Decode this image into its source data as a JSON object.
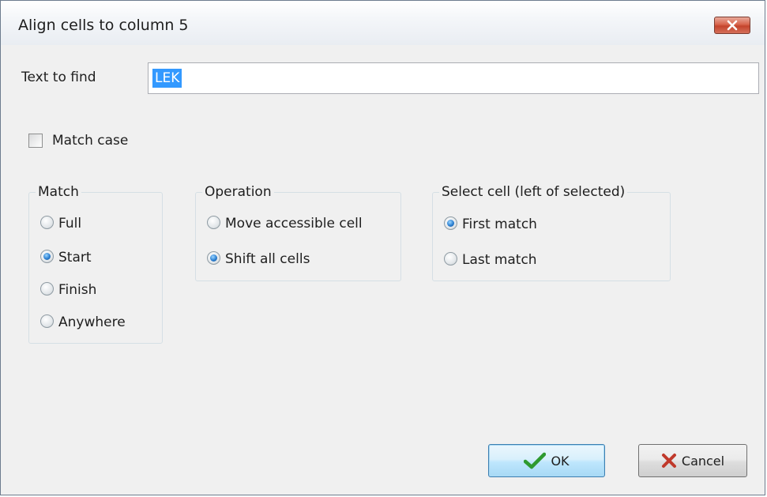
{
  "window": {
    "title": "Align cells to column 5"
  },
  "find": {
    "label": "Text to find",
    "value": "LEK"
  },
  "match_case": {
    "label": "Match case",
    "checked": false
  },
  "match_group": {
    "title": "Match",
    "options": [
      {
        "label": "Full",
        "checked": false
      },
      {
        "label": "Start",
        "checked": true
      },
      {
        "label": "Finish",
        "checked": false
      },
      {
        "label": "Anywhere",
        "checked": false
      }
    ]
  },
  "operation_group": {
    "title": "Operation",
    "options": [
      {
        "label": "Move accessible cell",
        "checked": false
      },
      {
        "label": "Shift all cells",
        "checked": true
      }
    ]
  },
  "select_group": {
    "title": "Select cell (left of selected)",
    "options": [
      {
        "label": "First match",
        "checked": true
      },
      {
        "label": "Last match",
        "checked": false
      }
    ]
  },
  "buttons": {
    "ok_label": "OK",
    "cancel_label": "Cancel"
  },
  "icons": {
    "close": "close-icon",
    "ok": "checkmark-icon",
    "cancel": "x-icon"
  },
  "colors": {
    "close_button": "#d8644c",
    "selection": "#3399ff",
    "checkmark": "#2f9a2f",
    "cancel_x": "#c0392b"
  }
}
